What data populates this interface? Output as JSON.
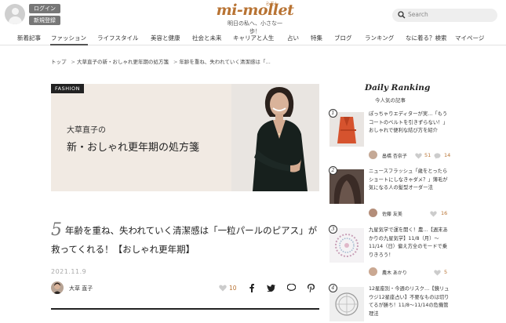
{
  "header": {
    "login_label": "ログイン",
    "register_label": "新規登録",
    "logo_text": "mi-mollet",
    "logo_ruby": "ミモレ",
    "tagline": "明日の私へ、小さな一歩！",
    "search_placeholder": "Search"
  },
  "nav": {
    "items": [
      "新着記事",
      "ファッション",
      "ライフスタイル",
      "美容と健康",
      "社会と未来",
      "キャリアと人生",
      "占い",
      "特集",
      "ブログ",
      "ランキング",
      "なに着る？検索",
      "マイページ"
    ],
    "active_index": 1
  },
  "breadcrumb": [
    "トップ",
    "大草直子の新・おしゃれ更年期の処方箋",
    "年齢を重ね、失われていく清潔感は「…"
  ],
  "hero": {
    "tag": "FASHION",
    "title_line1": "大草直子の",
    "title_line2": "新・おしゃれ更年期の処方箋"
  },
  "article": {
    "number": "5",
    "title": "年齢を重ね、失われていく清潔感は「一粒パールのピアス」が救ってくれる！【おしゃれ更年期】",
    "date": "2021.11.9",
    "author": "大草 直子",
    "likes": "10"
  },
  "sidebar": {
    "title": "Daily Ranking",
    "subtitle": "今人気の記事",
    "items": [
      {
        "rank": "1",
        "text": "ぽっちゃりエディターが実…「もうコートのベルトを引きずらない！」おしゃれで便利な結び方を紹介",
        "author": "畠橋 杏奈子",
        "likes": "51",
        "comments": "14"
      },
      {
        "rank": "2",
        "text": "ニュースフラッシュ「歳をとったらショートにしなきゃダメ？」薄毛が気になる人の髪型オーダー法",
        "author": "佐藤 友美",
        "likes": "16",
        "comments": ""
      },
      {
        "rank": "3",
        "text": "九星気学で運を開く！農…【週末あかりの九星気学】11/8（月）〜11/14（日）偏え方全のモードで乗りきろう！",
        "author": "農木 あかり",
        "likes": "5",
        "comments": ""
      },
      {
        "rank": "4",
        "text": "12星座別・今週のリスク…【鏡リュウジ12星座占い】不要なものは切りてるが勝ち！11/8〜11/14の危機管理法",
        "author": "",
        "likes": "",
        "comments": ""
      }
    ]
  },
  "colors": {
    "accent": "#b87333",
    "hero_bg": "#f1eae3",
    "tag_bg": "#222222"
  }
}
